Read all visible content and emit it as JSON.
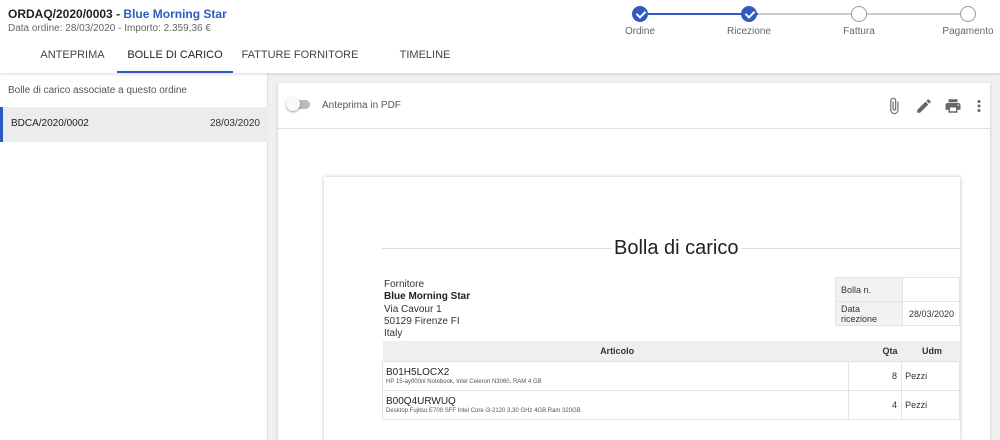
{
  "order": {
    "code": "ORDAQ/2020/0003",
    "separator": "-",
    "supplier": "Blue Morning Star",
    "subtitle": "Data ordine: 28/03/2020 - Importo: 2.359,36 €"
  },
  "tabs": [
    {
      "label": "ANTEPRIMA",
      "active": false
    },
    {
      "label": "BOLLE DI CARICO",
      "active": true
    },
    {
      "label": "FATTURE FORNITORE",
      "active": false
    },
    {
      "label": "TIMELINE",
      "active": false
    }
  ],
  "stepper": {
    "steps": [
      {
        "label": "Ordine",
        "done": true
      },
      {
        "label": "Ricezione",
        "done": true
      },
      {
        "label": "Fattura",
        "done": false
      },
      {
        "label": "Pagamento",
        "done": false
      }
    ]
  },
  "left_panel": {
    "heading": "Bolle di carico associate a questo ordine",
    "items": [
      {
        "code": "BDCA/2020/0002",
        "date": "28/03/2020",
        "selected": true
      }
    ]
  },
  "toolbar": {
    "pdf_toggle_label": "Anteprima in PDF",
    "pdf_toggle_on": false,
    "icons": [
      "attach-icon",
      "edit-icon",
      "print-icon",
      "more-vert-icon"
    ]
  },
  "document": {
    "title": "Bolla di carico",
    "supplier_label": "Fornitore",
    "supplier_name": "Blue Morning Star",
    "address_lines": [
      "Via Cavour 1",
      "50129 Firenze FI",
      "Italy"
    ],
    "meta": [
      {
        "key": "Bolla n.",
        "value": ""
      },
      {
        "key": "Data ricezione",
        "value": "28/03/2020"
      }
    ],
    "columns": {
      "article": "Articolo",
      "qty": "Qta",
      "uom": "Udm"
    },
    "rows": [
      {
        "code": "B01H5LOCX2",
        "description": "HP 15-ay000nl Notebook, Intel Celeron N3060, RAM 4 GB",
        "qty": "8",
        "uom": "Pezzi"
      },
      {
        "code": "B00Q4URWUQ",
        "description": "Desktop Fujitsu E700 SFF Intel Core i3-2120 3,30 GHz 4GB Ram 320GB",
        "qty": "4",
        "uom": "Pezzi"
      }
    ]
  },
  "colors": {
    "accent": "#2f5bc0",
    "selected_bg": "#ececec",
    "panel_bg": "#f0f0f0"
  }
}
